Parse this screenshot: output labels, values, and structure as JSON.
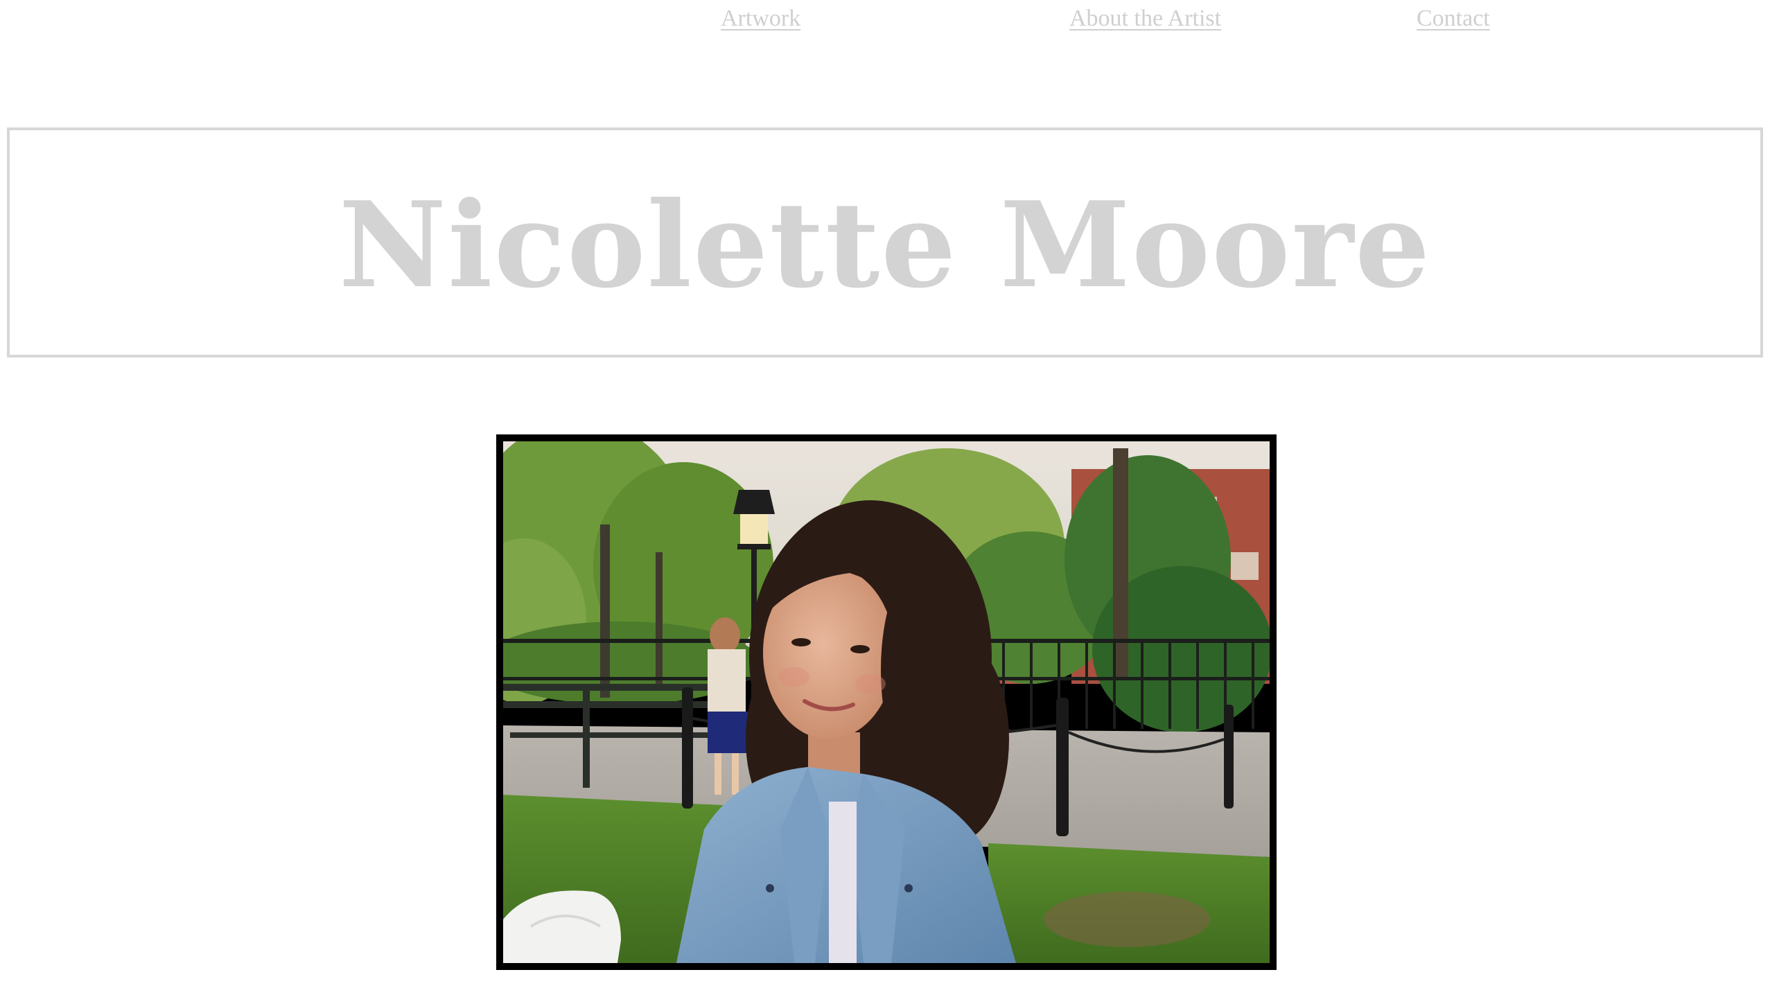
{
  "nav": {
    "artwork": "Artwork",
    "about": "About the Artist",
    "contact": "Contact"
  },
  "banner": {
    "title": "Nicolette Moore"
  },
  "colors": {
    "nav_text": "#cfcfcf",
    "banner_border": "#d7d7d7",
    "banner_text": "#d3d3d3",
    "photo_frame": "#000000"
  },
  "photo": {
    "subject": "artist-portrait-photo"
  }
}
